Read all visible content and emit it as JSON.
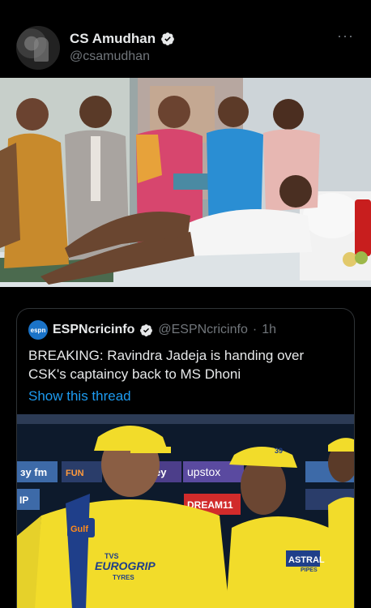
{
  "tweet": {
    "author_name": "CS Amudhan",
    "author_handle": "@csamudhan",
    "more_label": "···",
    "verified_icon": "verified-badge-icon"
  },
  "quoted_tweet": {
    "author_name": "ESPNcricinfo",
    "author_handle": "@ESPNcricinfo",
    "separator": "·",
    "time": "1h",
    "logo_text": "espn",
    "text": "BREAKING: Ravindra Jadeja is handing over CSK's captaincy back to MS Dhoni",
    "show_thread": "Show this thread"
  },
  "photo_text": {
    "ad_upstox": "upstox",
    "ad_dream11": "DREAM11",
    "ad_ey": "ey",
    "ad_fm": "ɜy fm",
    "ad_fun": "FUN",
    "ad_ip": "IP",
    "shirt_gulf": "Gulf",
    "shirt_eurogrip": "EUROGRIP",
    "shirt_tyres": "TYRES",
    "shirt_tvs": "TVS",
    "shirt_astral": "ASTRAL",
    "shirt_pipes": "PIPES",
    "cap_number": "39"
  },
  "colors": {
    "background": "#000000",
    "text_primary": "#e7e9ea",
    "text_secondary": "#71767b",
    "link": "#1d9bf0",
    "verified": "#e7e9ea",
    "espn_blue": "#1a73c8",
    "csk_yellow": "#f2dc2a"
  }
}
